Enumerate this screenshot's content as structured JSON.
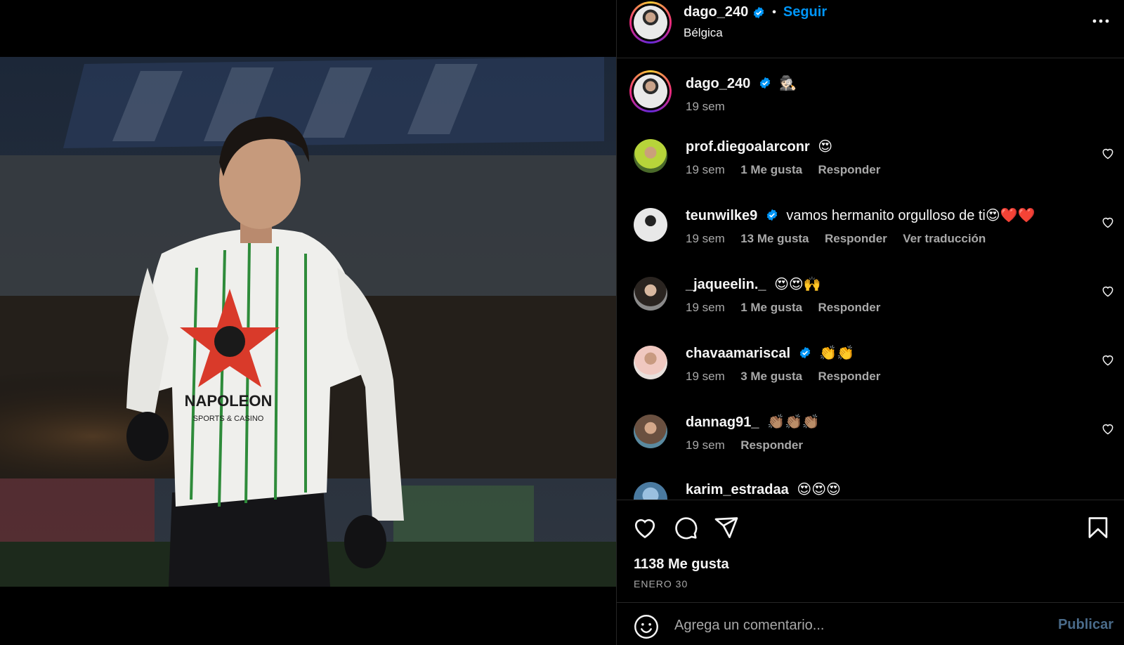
{
  "post": {
    "author": "dago_240",
    "follow_label": "Seguir",
    "location": "Bélgica",
    "caption_emoji": "🕵🏻",
    "caption_time": "19 sem",
    "likes": "1138 Me gusta",
    "date": "ENERO 30",
    "accent_color": "#0095f6"
  },
  "comments": [
    {
      "user": "prof.diegoalarconr",
      "verified": false,
      "text": "😍",
      "time": "19 sem",
      "likes": "1 Me gusta",
      "reply": "Responder",
      "translate": ""
    },
    {
      "user": "teunwilke9",
      "verified": true,
      "text": "vamos hermanito orgulloso de ti😍❤️❤️",
      "time": "19 sem",
      "likes": "13 Me gusta",
      "reply": "Responder",
      "translate": "Ver traducción"
    },
    {
      "user": "_jaqueelin._",
      "verified": false,
      "text": "😍😍🙌",
      "time": "19 sem",
      "likes": "1 Me gusta",
      "reply": "Responder",
      "translate": ""
    },
    {
      "user": "chavaamariscal",
      "verified": true,
      "text": "👏👏",
      "time": "19 sem",
      "likes": "3 Me gusta",
      "reply": "Responder",
      "translate": ""
    },
    {
      "user": "dannag91_",
      "verified": false,
      "text": "👏🏽👏🏽👏🏽",
      "time": "19 sem",
      "likes": "",
      "reply": "Responder",
      "translate": ""
    },
    {
      "user": "karim_estradaa",
      "verified": false,
      "text": "😍😍😍",
      "time": "",
      "likes": "",
      "reply": "",
      "translate": ""
    }
  ],
  "composer": {
    "placeholder": "Agrega un comentario...",
    "publish_label": "Publicar"
  },
  "jersey": {
    "sponsor": "NAPOLEON",
    "sponsor_sub": "SPORTS & CASINO"
  },
  "icons": [
    "more-icon",
    "verified-icon",
    "heart-icon",
    "comment-icon",
    "share-icon",
    "bookmark-icon",
    "emoji-icon"
  ]
}
